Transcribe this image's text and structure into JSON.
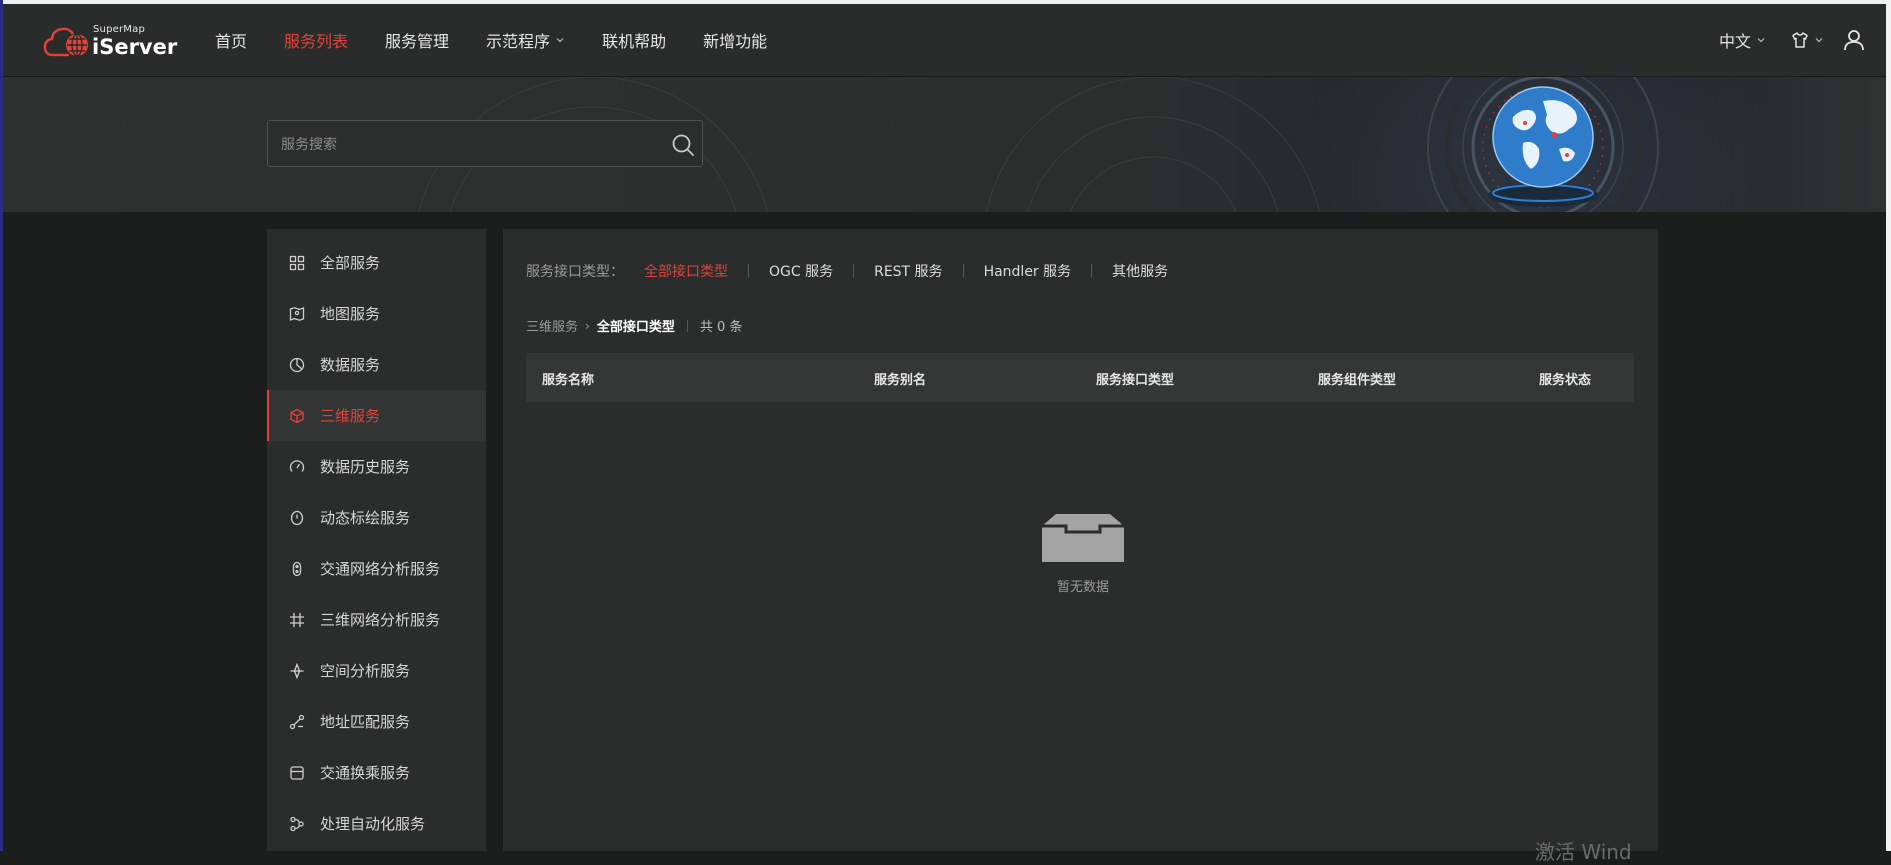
{
  "header": {
    "logo_small": "SuperMap",
    "logo_big": "iServer",
    "nav": [
      {
        "label": "首页",
        "active": false,
        "dropdown": false
      },
      {
        "label": "服务列表",
        "active": true,
        "dropdown": false
      },
      {
        "label": "服务管理",
        "active": false,
        "dropdown": false
      },
      {
        "label": "示范程序",
        "active": false,
        "dropdown": true
      },
      {
        "label": "联机帮助",
        "active": false,
        "dropdown": false
      },
      {
        "label": "新增功能",
        "active": false,
        "dropdown": false
      }
    ],
    "language": "中文",
    "icons": [
      "chevron-down-icon",
      "tshirt-icon",
      "user-icon"
    ]
  },
  "search": {
    "placeholder": "服务搜索",
    "value": "",
    "icon": "search-icon"
  },
  "sidebar": {
    "items": [
      {
        "label": "全部服务",
        "icon": "grid-icon",
        "active": false
      },
      {
        "label": "地图服务",
        "icon": "map-icon",
        "active": false
      },
      {
        "label": "数据服务",
        "icon": "pie-chart-icon",
        "active": false
      },
      {
        "label": "三维服务",
        "icon": "cube-icon",
        "active": true
      },
      {
        "label": "数据历史服务",
        "icon": "gauge-icon",
        "active": false
      },
      {
        "label": "动态标绘服务",
        "icon": "plot-icon",
        "active": false
      },
      {
        "label": "交通网络分析服务",
        "icon": "route-icon",
        "active": false
      },
      {
        "label": "三维网络分析服务",
        "icon": "mesh-icon",
        "active": false
      },
      {
        "label": "空间分析服务",
        "icon": "compass-icon",
        "active": false
      },
      {
        "label": "地址匹配服务",
        "icon": "address-icon",
        "active": false
      },
      {
        "label": "交通换乘服务",
        "icon": "transit-icon",
        "active": false
      },
      {
        "label": "处理自动化服务",
        "icon": "workflow-icon",
        "active": false
      }
    ]
  },
  "filter": {
    "label": "服务接口类型：",
    "options": [
      {
        "label": "全部接口类型",
        "active": true
      },
      {
        "label": "OGC 服务",
        "active": false
      },
      {
        "label": "REST 服务",
        "active": false
      },
      {
        "label": "Handler 服务",
        "active": false
      },
      {
        "label": "其他服务",
        "active": false
      }
    ]
  },
  "breadcrumb": {
    "parent": "三维服务",
    "current": "全部接口类型",
    "count": "共 0 条"
  },
  "table": {
    "columns": [
      "服务名称",
      "服务别名",
      "服务接口类型",
      "服务组件类型",
      "服务状态"
    ],
    "rows": []
  },
  "empty": {
    "text": "暂无数据",
    "icon": "empty-inbox-icon"
  },
  "overlay": {
    "watermark": "激活 Wind"
  },
  "colors": {
    "accent": "#e0433b",
    "background": "#1c1e1d",
    "panel": "#2b2c2c",
    "header": "#2a2b2b"
  }
}
